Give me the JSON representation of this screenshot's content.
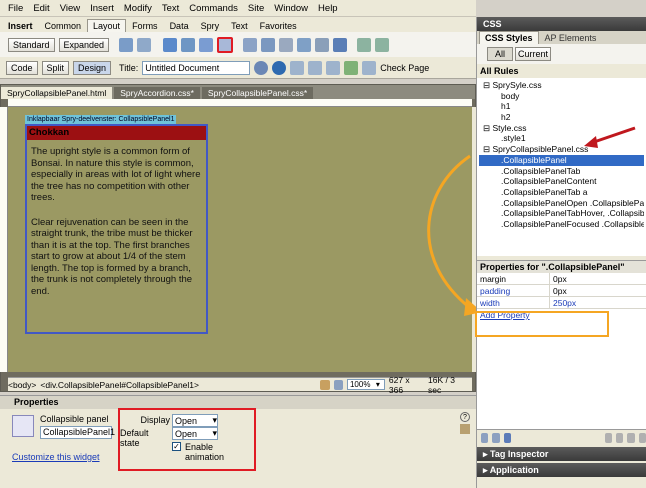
{
  "menu": [
    "File",
    "Edit",
    "View",
    "Insert",
    "Modify",
    "Text",
    "Commands",
    "Site",
    "Window",
    "Help"
  ],
  "insert_bar": {
    "title": "Insert",
    "tabs": [
      "Common",
      "Layout",
      "Forms",
      "Data",
      "Spry",
      "Text",
      "Favorites"
    ],
    "active_tab": "Layout",
    "mode_buttons": [
      "Standard",
      "Expanded"
    ]
  },
  "doc_toolbar": {
    "code": "Code",
    "split": "Split",
    "design": "Design",
    "title_label": "Title:",
    "title_value": "Untitled Document",
    "check_page": "Check Page"
  },
  "doc_tabs": [
    "SpryCollapsiblePanel.html",
    "SpryAccordion.css*",
    "SpryCollapsiblePanel.css*"
  ],
  "canvas": {
    "spry_label": "Inklapbaar Spry-deelvenster: CollapsiblePanel1",
    "panel_tab": "Chokkan",
    "paragraphs": [
      "The upright style is a common form of Bonsai. In nature this style is common, especially in areas with lot of  light  where the tree has no competition with other trees.",
      "Clear rejuvenation can be seen in the straight trunk, the tribe must be thicker than it is at the top. The first branches start to grow at about 1/4 of the stem length. The top is formed by a branch, the trunk is not completely through the end."
    ]
  },
  "status": {
    "tag_body": "<body>",
    "tag_div": "<div.CollapsiblePanel#CollapsiblePanel1>",
    "zoom": "100%",
    "size": "627 x 366",
    "weight": "16K / 3 sec"
  },
  "properties": {
    "title": "Properties",
    "widget_type": "Collapsible panel",
    "widget_name": "CollapsiblePanel1",
    "customize": "Customize this widget",
    "display_label": "Display",
    "display_value": "Open",
    "default_state_label": "Default state",
    "default_state_value": "Open",
    "animation_label": "Enable animation"
  },
  "css_panel": {
    "header": "CSS",
    "tabs": [
      "CSS Styles",
      "AP Elements"
    ],
    "mode_buttons": [
      "All",
      "Current"
    ],
    "all_rules": "All Rules",
    "tree": [
      {
        "t": "SprySyle.css",
        "lvl": 0
      },
      {
        "t": "body",
        "lvl": 2
      },
      {
        "t": "h1",
        "lvl": 2
      },
      {
        "t": "h2",
        "lvl": 2
      },
      {
        "t": "Style.css",
        "lvl": 0
      },
      {
        "t": ".style1",
        "lvl": 2
      },
      {
        "t": "SpryCollapsiblePanel.css",
        "lvl": 0
      },
      {
        "t": ".CollapsiblePanel",
        "lvl": 2,
        "sel": true
      },
      {
        "t": ".CollapsiblePanelTab",
        "lvl": 2
      },
      {
        "t": ".CollapsiblePanelContent",
        "lvl": 2
      },
      {
        "t": ".CollapsiblePanelTab a",
        "lvl": 2
      },
      {
        "t": ".CollapsiblePanelOpen .CollapsiblePane",
        "lvl": 2
      },
      {
        "t": ".CollapsiblePanelTabHover, .Collapsible",
        "lvl": 2
      },
      {
        "t": ".CollapsiblePanelFocused .Collapsible",
        "lvl": 2
      }
    ],
    "props_title": "Properties for \".CollapsiblePanel\"",
    "props": [
      {
        "k": "margin",
        "v": "0px"
      },
      {
        "k": "padding",
        "v": "0px"
      },
      {
        "k": "width",
        "v": "250px"
      }
    ],
    "add_property": "Add Property",
    "tag_inspector": "Tag Inspector",
    "application": "Application"
  }
}
